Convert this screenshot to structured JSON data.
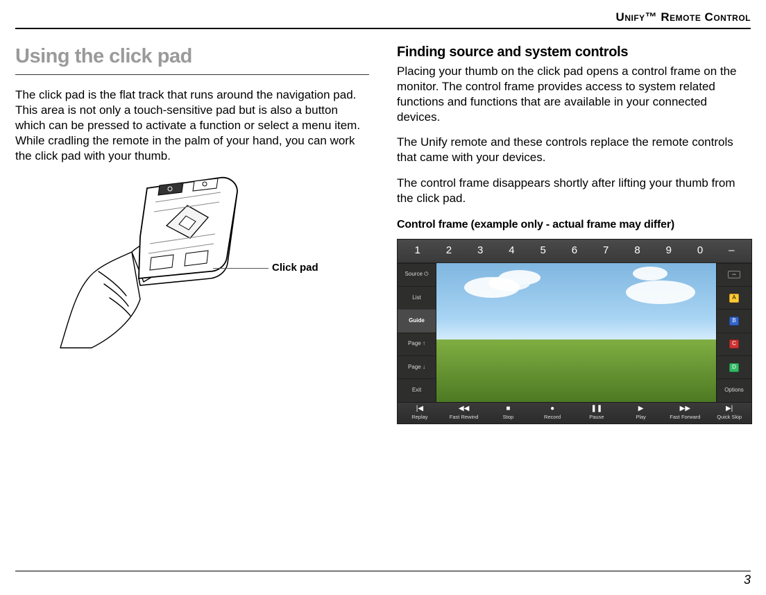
{
  "header": {
    "title": "Unify™ Remote Control"
  },
  "left": {
    "title": "Using the click pad",
    "para": "The click pad is the flat track that runs around the navigation pad. This area is not only a touch-sensitive pad but is also a button which can be pressed to activate a function or select a menu item. While cradling the remote in the palm of your hand, you can work the click pad with your thumb.",
    "callout": "Click pad"
  },
  "right": {
    "title": "Finding source and system controls",
    "para1": "Placing your thumb on the click pad opens a control frame on the monitor. The control frame provides access to system related functions and functions that are available in your connected devices.",
    "para2": "The Unify remote and these controls replace the remote controls that came with your devices.",
    "para3": "The control frame disappears shortly after lifting your thumb from the click pad.",
    "example_caption": "Control frame (example only - actual frame may differ)"
  },
  "control_frame": {
    "numbers": [
      "1",
      "2",
      "3",
      "4",
      "5",
      "6",
      "7",
      "8",
      "9",
      "0",
      "–"
    ],
    "left_items": [
      {
        "label": "Source ⏻",
        "hl": false
      },
      {
        "label": "List",
        "hl": false
      },
      {
        "label": "Guide",
        "hl": true
      },
      {
        "label": "Page ↑",
        "hl": false
      },
      {
        "label": "Page ↓",
        "hl": false
      },
      {
        "label": "Exit",
        "hl": false
      }
    ],
    "right_items": [
      {
        "label": "",
        "icon": "ratio"
      },
      {
        "label": "A",
        "icon": "yellow"
      },
      {
        "label": "B",
        "icon": "blue"
      },
      {
        "label": "C",
        "icon": "red"
      },
      {
        "label": "D",
        "icon": "green"
      },
      {
        "label": "Options",
        "icon": ""
      }
    ],
    "bottom_items": [
      {
        "label": "Replay",
        "glyph": "|◀"
      },
      {
        "label": "Fast Rewind",
        "glyph": "◀◀"
      },
      {
        "label": "Stop",
        "glyph": "■"
      },
      {
        "label": "Record",
        "glyph": "●"
      },
      {
        "label": "Pause",
        "glyph": "❚❚"
      },
      {
        "label": "Play",
        "glyph": "▶"
      },
      {
        "label": "Fast Forward",
        "glyph": "▶▶"
      },
      {
        "label": "Quick Skip",
        "glyph": "▶|"
      }
    ]
  },
  "page_number": "3"
}
